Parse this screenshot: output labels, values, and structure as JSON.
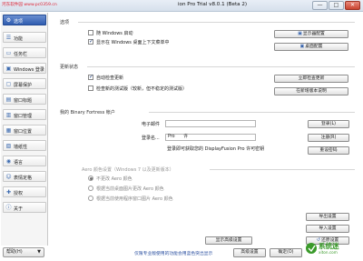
{
  "window": {
    "watermark": "河东软件园 www.pc0359.cn",
    "title": "ion Pro Trial v8.0.1 (Beta 2)",
    "controls": [
      "—",
      "□",
      "✕"
    ]
  },
  "sidebar": {
    "items": [
      {
        "label": "选项",
        "icon": "gear-icon",
        "glyph": "⚙",
        "active": true
      },
      {
        "label": "功能",
        "icon": "list-icon",
        "glyph": "☰"
      },
      {
        "label": "任务栏",
        "icon": "taskbar-icon",
        "glyph": "▭"
      },
      {
        "label": "Windows 登录",
        "icon": "lock-icon",
        "glyph": "▣"
      },
      {
        "label": "屏幕保护",
        "icon": "monitor-icon",
        "glyph": "▢"
      },
      {
        "label": "窗口标题",
        "icon": "window-icon",
        "glyph": "▤"
      },
      {
        "label": "窗口管理",
        "icon": "window-manage-icon",
        "glyph": "▥"
      },
      {
        "label": "窗口位置",
        "icon": "window-position-icon",
        "glyph": "▦"
      },
      {
        "label": "墙纸性",
        "icon": "wallpaper-icon",
        "glyph": "▧"
      },
      {
        "label": "语言",
        "icon": "speech-icon",
        "glyph": "◉"
      },
      {
        "label": "表情定格",
        "icon": "emoji-icon",
        "glyph": "☺"
      },
      {
        "label": "授权",
        "icon": "key-icon",
        "glyph": "✚"
      },
      {
        "label": "关于",
        "icon": "info-icon",
        "glyph": "ⓘ"
      }
    ],
    "help_button": "帮助(H)",
    "help_caret": "▼"
  },
  "options": {
    "heading": "选项",
    "startup_label": "随 Windows 启动",
    "startup_checked": false,
    "tray_label": "显示在 Windows 桌面上下文菜单中",
    "tray_checked": true,
    "button_display": "显示器配置",
    "button_desktop": "桌面配置"
  },
  "updates": {
    "heading": "更新状态",
    "auto_label": "自动检查更新",
    "auto_checked": true,
    "beta_label": "检查新的测试版（较新，但不稳定的测试版）",
    "beta_checked": false,
    "button_check": "立即检查更新",
    "button_changelog": "在新增版本说明"
  },
  "account": {
    "heading": "我的 Binary Fortress 帐户",
    "email_label": "电子邮件",
    "email_value": "",
    "password_label": "登录名...",
    "password_value": "Pro　　许",
    "note": "登录即可获取您的 DisplayFusion Pro 许可密钥",
    "button_login": "登录(L)",
    "button_register": "注册(R)",
    "button_reset": "重设密码"
  },
  "aero": {
    "heading": "Aero 颜色设置（Windows 7 以及更新版本）",
    "options": [
      {
        "label": "不更改 Aero 颜色",
        "selected": true
      },
      {
        "label": "根据当前桌面图片更改 Aero 颜色",
        "selected": false
      },
      {
        "label": "根据当前使用程序窗口图片 Aero 颜色",
        "selected": false
      }
    ]
  },
  "bottom_actions": {
    "export": "导出设置",
    "import": "导入设置",
    "advanced": "显示高级设置",
    "restore": "还原设置"
  },
  "footer": {
    "note": "仅限专业版使用的功能会用蓝色突出显示",
    "advanced": "高级设置",
    "ok": "确定(O)"
  },
  "logo": {
    "text": "系统迷",
    "domain": "xiton.com"
  },
  "colors": {
    "accent": "#2f5db0",
    "pro_note": "#2a4fa0",
    "logo_green": "#3a9a2a"
  }
}
